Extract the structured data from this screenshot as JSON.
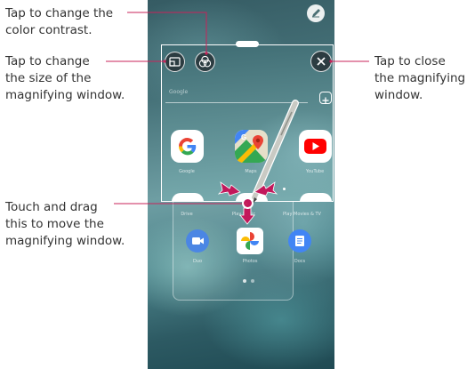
{
  "callouts": {
    "contrast_line1": "Tap to change the",
    "contrast_line2": "color contrast.",
    "size_line1": "Tap to change",
    "size_line2": "the size of the",
    "size_line3": "magnifying window.",
    "close_line1": "Tap to close",
    "close_line2": "the magnifying",
    "close_line3": "window.",
    "drag_line1": "Touch and drag",
    "drag_line2": "this to move the",
    "drag_line3": "magnifying window."
  },
  "search": {
    "text": "Google"
  },
  "apps": {
    "google": "Google",
    "maps": "Maps",
    "youtube": "YouTube",
    "drive": "Drive",
    "play_music": "Play Music",
    "play_movies": "Play Movies & TV",
    "duo": "Duo",
    "photos": "Photos",
    "docs": "Docs"
  },
  "colors": {
    "callout_line": "#c8235a",
    "window_border": "#ffffff",
    "pen_gray": "#c9cac4"
  },
  "icons": {
    "contrast": "overlapping-circles-icon",
    "resize": "resize-window-icon",
    "close": "close-icon",
    "add": "plus-icon",
    "pen": "pen-icon",
    "move": "move-handle-icon"
  }
}
